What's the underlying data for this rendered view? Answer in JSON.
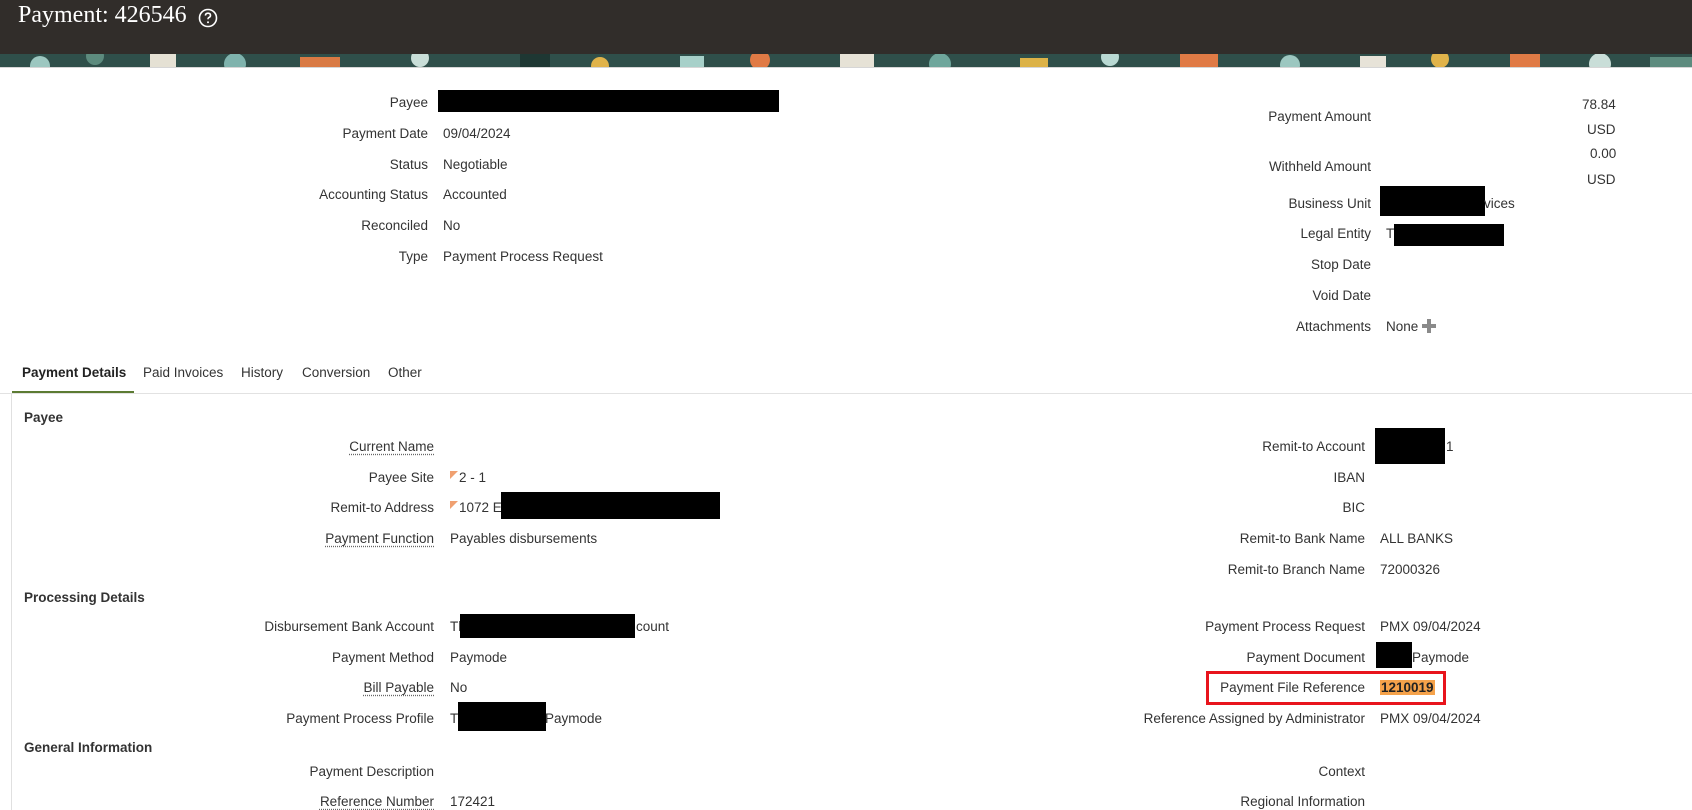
{
  "header": {
    "title": "Payment: 426546",
    "help_icon": "help-circle-icon"
  },
  "summary": {
    "payee_label": "Payee",
    "payment_date_label": "Payment Date",
    "payment_date": "09/04/2024",
    "status_label": "Status",
    "status": "Negotiable",
    "accounting_status_label": "Accounting Status",
    "accounting_status": "Accounted",
    "reconciled_label": "Reconciled",
    "reconciled": "No",
    "type_label": "Type",
    "type": "Payment Process Request",
    "payment_amount_label": "Payment Amount",
    "payment_amount": "78.84",
    "payment_currency": "USD",
    "withheld_amount_label": "Withheld Amount",
    "withheld_amount": "0.00",
    "withheld_currency": "USD",
    "business_unit_label": "Business Unit",
    "business_unit_suffix": "vices",
    "legal_entity_label": "Legal Entity",
    "legal_entity_prefix": "T",
    "stop_date_label": "Stop Date",
    "void_date_label": "Void Date",
    "attachments_label": "Attachments",
    "attachments": "None"
  },
  "tabs": [
    {
      "label": "Payment Details",
      "active": true
    },
    {
      "label": "Paid Invoices"
    },
    {
      "label": "History"
    },
    {
      "label": "Conversion"
    },
    {
      "label": "Other"
    }
  ],
  "payee_section": {
    "title": "Payee",
    "current_name_label": "Current Name",
    "payee_site_label": "Payee Site",
    "payee_site": "2 - 1",
    "remit_address_label": "Remit-to Address",
    "remit_address_prefix": "1072 E",
    "payment_function_label": "Payment Function",
    "payment_function": "Payables disbursements",
    "remit_account_label": "Remit-to Account",
    "remit_account_suffix": "1",
    "iban_label": "IBAN",
    "bic_label": "BIC",
    "remit_bank_label": "Remit-to Bank Name",
    "remit_bank": "ALL BANKS",
    "remit_branch_label": "Remit-to Branch Name",
    "remit_branch": "72000326"
  },
  "processing_section": {
    "title": "Processing Details",
    "disb_account_label": "Disbursement Bank Account",
    "disb_account_prefix": "Th",
    "disb_account_suffix": "count",
    "payment_method_label": "Payment Method",
    "payment_method": "Paymode",
    "bill_payable_label": "Bill Payable",
    "bill_payable": "No",
    "ppp_label": "Payment Process Profile",
    "ppp_prefix": "T",
    "ppp_suffix": "Paymode",
    "ppr_label": "Payment Process Request",
    "ppr": "PMX 09/04/2024",
    "payment_document_label": "Payment Document",
    "payment_document_suffix": "Paymode",
    "file_ref_label": "Payment File Reference",
    "file_ref": "1210019",
    "ref_admin_label": "Reference Assigned by Administrator",
    "ref_admin": "PMX 09/04/2024"
  },
  "general_section": {
    "title": "General Information",
    "payment_description_label": "Payment Description",
    "reference_number_label": "Reference Number",
    "reference_number": "172421",
    "context_label": "Context",
    "regional_info_label": "Regional Information"
  },
  "colors": {
    "header_bg": "#312d2a",
    "tab_accent": "#5c7b33",
    "highlight_border": "#e8141c",
    "highlight_fill": "#f5a24a"
  }
}
